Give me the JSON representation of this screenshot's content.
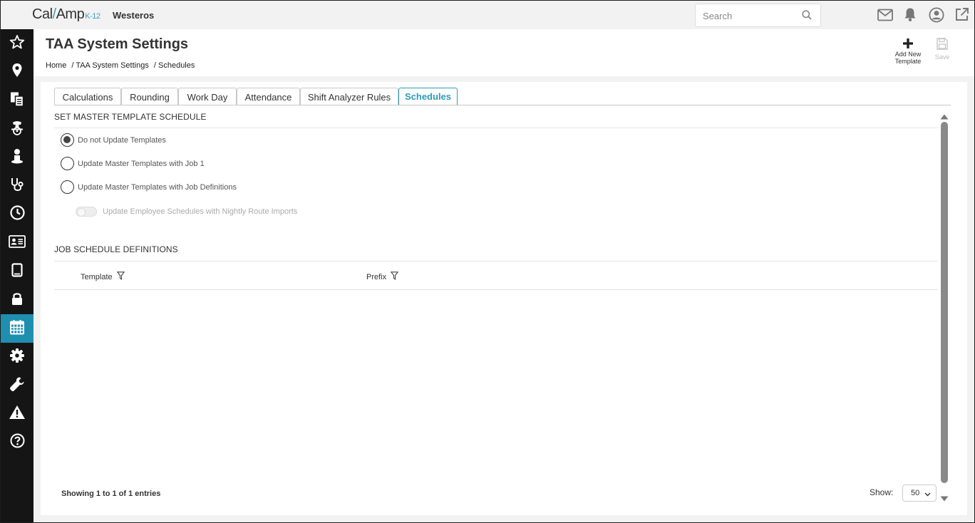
{
  "brand": {
    "logo_main": "Cal",
    "logo_slash": "/",
    "logo_tail": "Amp",
    "logo_suffix": "K-12",
    "site": "Westeros"
  },
  "search": {
    "placeholder": "Search"
  },
  "topbar_icons": [
    "mail-icon",
    "bell-icon",
    "user-circle-icon",
    "external-link-icon"
  ],
  "sidebar": {
    "items": [
      {
        "icon": "star-icon"
      },
      {
        "icon": "map-pin-icon"
      },
      {
        "icon": "documents-icon"
      },
      {
        "icon": "bus-driver-icon"
      },
      {
        "icon": "person-icon"
      },
      {
        "icon": "stethoscope-icon"
      },
      {
        "icon": "clock-icon"
      },
      {
        "icon": "id-card-icon"
      },
      {
        "icon": "tablet-icon"
      },
      {
        "icon": "lock-icon"
      },
      {
        "icon": "calendar-icon",
        "active": true
      },
      {
        "icon": "gear-icon"
      },
      {
        "icon": "wrench-icon"
      },
      {
        "icon": "warning-icon"
      },
      {
        "icon": "help-icon"
      }
    ]
  },
  "header": {
    "title": "TAA System Settings",
    "breadcrumb": [
      "Home",
      "/ TAA System Settings",
      "/ Schedules"
    ],
    "add_label_1": "Add New",
    "add_label_2": "Template",
    "save_label": "Save"
  },
  "tabs": [
    {
      "label": "Calculations"
    },
    {
      "label": "Rounding"
    },
    {
      "label": "Work Day"
    },
    {
      "label": "Attendance"
    },
    {
      "label": "Shift Analyzer Rules"
    },
    {
      "label": "Schedules",
      "active": true
    }
  ],
  "master": {
    "title": "SET MASTER TEMPLATE SCHEDULE",
    "options": [
      {
        "label": "Do not Update Templates",
        "checked": true
      },
      {
        "label": "Update Master Templates with Job 1",
        "checked": false
      },
      {
        "label": "Update Master Templates with Job Definitions",
        "checked": false
      }
    ],
    "toggle_label": "Update Employee Schedules with Nightly Route Imports"
  },
  "jobs": {
    "title": "JOB SCHEDULE DEFINITIONS",
    "columns": [
      "Template",
      "Prefix"
    ],
    "info": "Showing 1 to 1 of 1 entries",
    "show_label": "Show:",
    "show_value": "50"
  },
  "colors": {
    "accent": "#2a9db8",
    "sidebar_bg": "#151515",
    "sidebar_active": "#1f8fb0"
  }
}
